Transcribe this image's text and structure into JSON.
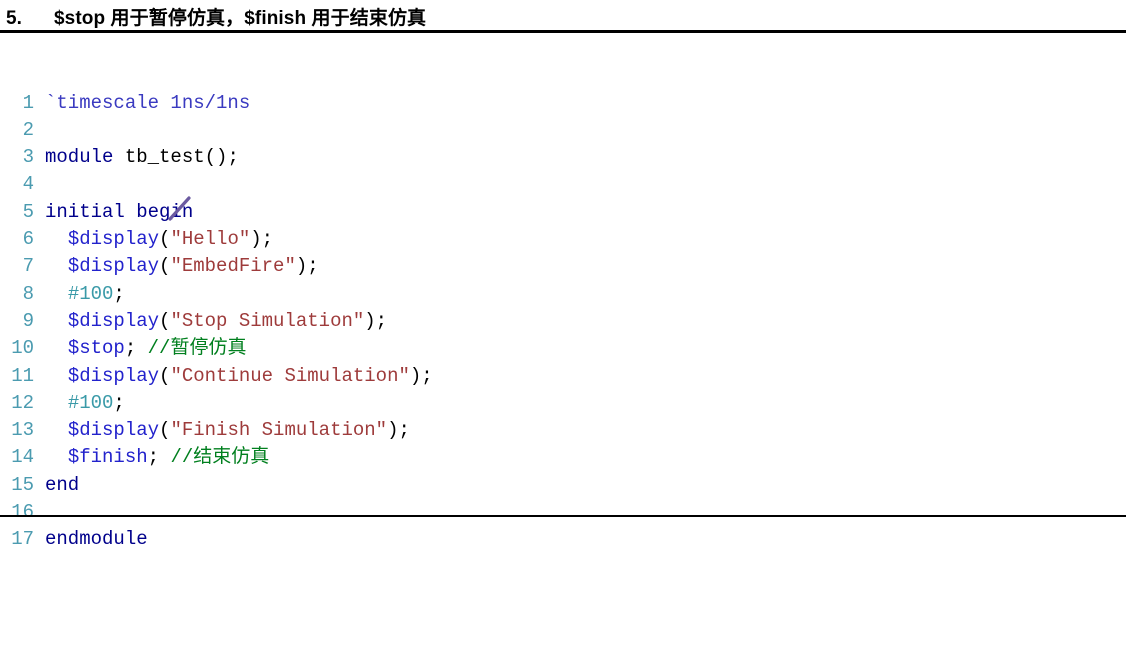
{
  "heading": {
    "number": "5.",
    "text": "$stop 用于暂停仿真，$finish 用于结束仿真"
  },
  "colors": {
    "keyword": "#00008b",
    "directive": "#3a3ac0",
    "system_task": "#2222cc",
    "string": "#9e3b3b",
    "number": "#3a9aa8",
    "comment": "#007f1e",
    "punctuation": "#000000",
    "line_number": "#4b9bb0",
    "rule": "#000000",
    "background": "#ffffff",
    "annotation_stroke": "#6b5aa0"
  },
  "code": {
    "language": "verilog",
    "first_line_number": 1,
    "last_line_number": 17,
    "lines": [
      {
        "n": "1",
        "text": "`timescale 1ns/1ns",
        "tokens": [
          {
            "t": "`timescale 1ns/1ns",
            "c": "t-dir"
          }
        ]
      },
      {
        "n": "2",
        "text": "",
        "tokens": []
      },
      {
        "n": "3",
        "text": "module tb_test();",
        "tokens": [
          {
            "t": "module",
            "c": "t-kw"
          },
          {
            "t": " tb_test();",
            "c": "t-pun"
          }
        ]
      },
      {
        "n": "4",
        "text": "",
        "tokens": []
      },
      {
        "n": "5",
        "text": "initial begin",
        "tokens": [
          {
            "t": "initial begin",
            "c": "t-kw"
          }
        ]
      },
      {
        "n": "6",
        "text": "  $display(\"Hello\");",
        "tokens": [
          {
            "t": "  ",
            "c": "t-pun"
          },
          {
            "t": "$display",
            "c": "t-sys"
          },
          {
            "t": "(",
            "c": "t-pun"
          },
          {
            "t": "\"Hello\"",
            "c": "t-str"
          },
          {
            "t": ");",
            "c": "t-pun"
          }
        ]
      },
      {
        "n": "7",
        "text": "  $display(\"EmbedFire\");",
        "tokens": [
          {
            "t": "  ",
            "c": "t-pun"
          },
          {
            "t": "$display",
            "c": "t-sys"
          },
          {
            "t": "(",
            "c": "t-pun"
          },
          {
            "t": "\"EmbedFire\"",
            "c": "t-str"
          },
          {
            "t": ");",
            "c": "t-pun"
          }
        ]
      },
      {
        "n": "8",
        "text": "  #100;",
        "tokens": [
          {
            "t": "  ",
            "c": "t-pun"
          },
          {
            "t": "#100",
            "c": "t-num"
          },
          {
            "t": ";",
            "c": "t-pun"
          }
        ]
      },
      {
        "n": "9",
        "text": "  $display(\"Stop Simulation\");",
        "tokens": [
          {
            "t": "  ",
            "c": "t-pun"
          },
          {
            "t": "$display",
            "c": "t-sys"
          },
          {
            "t": "(",
            "c": "t-pun"
          },
          {
            "t": "\"Stop Simulation\"",
            "c": "t-str"
          },
          {
            "t": ");",
            "c": "t-pun"
          }
        ]
      },
      {
        "n": "10",
        "text": "  $stop; //暂停仿真",
        "tokens": [
          {
            "t": "  ",
            "c": "t-pun"
          },
          {
            "t": "$stop",
            "c": "t-sys"
          },
          {
            "t": "; ",
            "c": "t-pun"
          },
          {
            "t": "//暂停仿真",
            "c": "t-cmt"
          }
        ]
      },
      {
        "n": "11",
        "text": "  $display(\"Continue Simulation\");",
        "tokens": [
          {
            "t": "  ",
            "c": "t-pun"
          },
          {
            "t": "$display",
            "c": "t-sys"
          },
          {
            "t": "(",
            "c": "t-pun"
          },
          {
            "t": "\"Continue Simulation\"",
            "c": "t-str"
          },
          {
            "t": ");",
            "c": "t-pun"
          }
        ]
      },
      {
        "n": "12",
        "text": "  #100;",
        "tokens": [
          {
            "t": "  ",
            "c": "t-pun"
          },
          {
            "t": "#100",
            "c": "t-num"
          },
          {
            "t": ";",
            "c": "t-pun"
          }
        ]
      },
      {
        "n": "13",
        "text": "  $display(\"Finish Simulation\");",
        "tokens": [
          {
            "t": "  ",
            "c": "t-pun"
          },
          {
            "t": "$display",
            "c": "t-sys"
          },
          {
            "t": "(",
            "c": "t-pun"
          },
          {
            "t": "\"Finish Simulation\"",
            "c": "t-str"
          },
          {
            "t": ");",
            "c": "t-pun"
          }
        ]
      },
      {
        "n": "14",
        "text": "  $finish; //结束仿真",
        "tokens": [
          {
            "t": "  ",
            "c": "t-pun"
          },
          {
            "t": "$finish",
            "c": "t-sys"
          },
          {
            "t": "; ",
            "c": "t-pun"
          },
          {
            "t": "//结束仿真",
            "c": "t-cmt"
          }
        ]
      },
      {
        "n": "15",
        "text": "end",
        "tokens": [
          {
            "t": "end",
            "c": "t-kw"
          }
        ]
      },
      {
        "n": "16",
        "text": "",
        "tokens": []
      },
      {
        "n": "17",
        "text": "endmodule",
        "tokens": [
          {
            "t": "endmodule",
            "c": "t-kw"
          }
        ]
      }
    ]
  },
  "annotation": {
    "type": "pen-stroke",
    "description": "diagonal pen mark over line 6"
  }
}
